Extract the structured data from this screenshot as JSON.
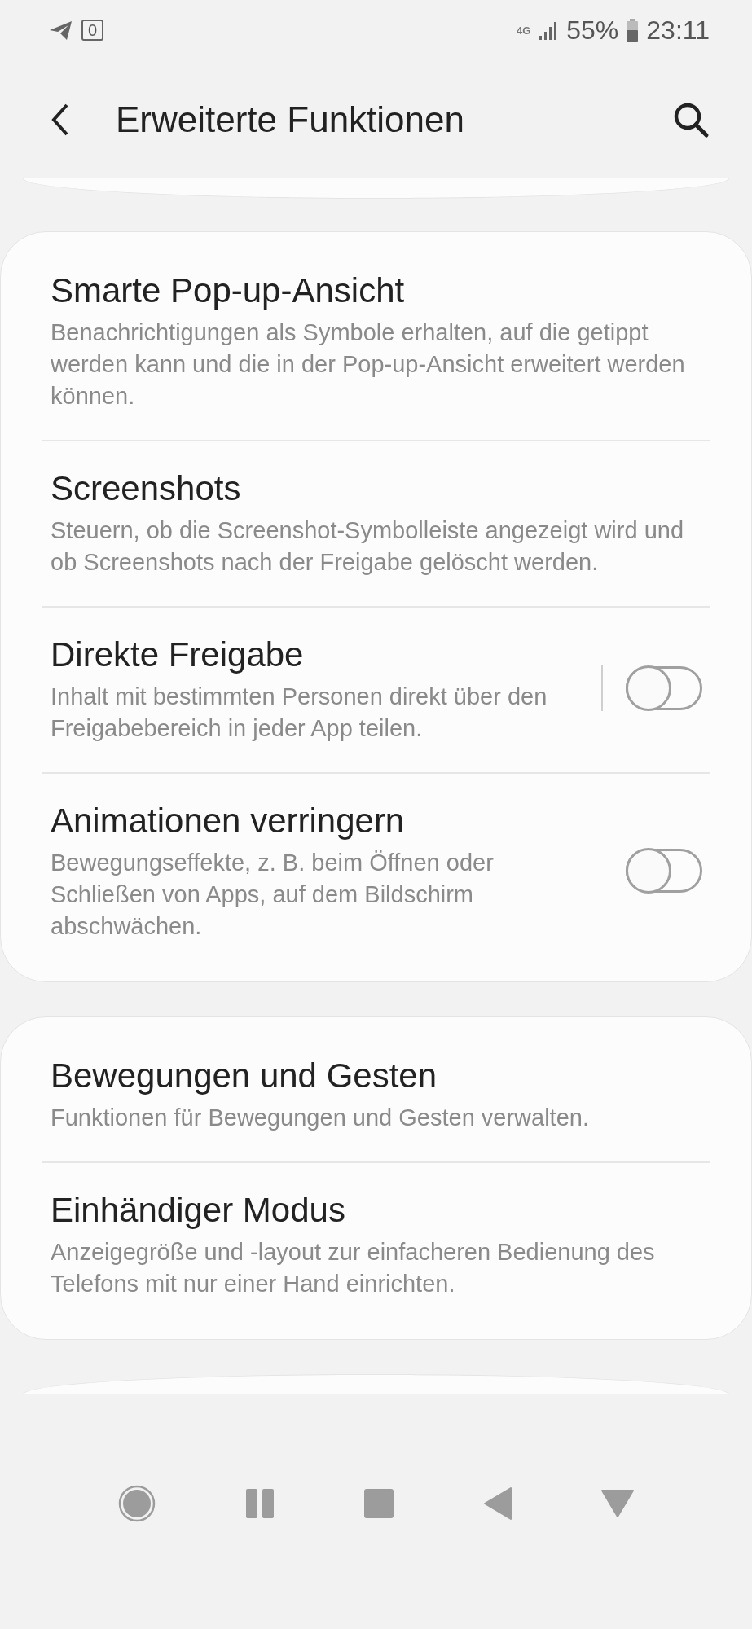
{
  "status_bar": {
    "notification_count": "0",
    "network": "4G",
    "battery": "55%",
    "time": "23:11"
  },
  "header": {
    "title": "Erweiterte Funktionen"
  },
  "groups": [
    {
      "items": [
        {
          "kind": "text",
          "title": "Smarte Pop-up-Ansicht",
          "description": "Benachrichtigungen als Symbole erhalten, auf die getippt werden kann und die in der Pop-up-Ansicht erweitert werden können."
        },
        {
          "kind": "text",
          "title": "Screenshots",
          "description": "Steuern, ob die Screenshot-Symbolleiste angezeigt wird und ob Screenshots nach der Freigabe gelöscht werden."
        },
        {
          "kind": "switch",
          "title": "Direkte Freigabe",
          "description": "Inhalt mit bestimmten Personen direkt über den Freigabebereich in jeder App teilen.",
          "on": false,
          "separated": true
        },
        {
          "kind": "switch",
          "title": "Animationen verringern",
          "description": "Bewegungseffekte, z. B. beim Öffnen oder Schließen von Apps, auf dem Bildschirm abschwächen.",
          "on": false,
          "separated": false
        }
      ]
    },
    {
      "items": [
        {
          "kind": "text",
          "title": "Bewegungen und Gesten",
          "description": "Funktionen für Bewegungen und Gesten verwalten."
        },
        {
          "kind": "text",
          "title": "Einhändiger Modus",
          "description": "Anzeigegröße und -layout zur einfacheren Bedienung des Telefons mit nur einer Hand einrichten."
        }
      ]
    }
  ]
}
